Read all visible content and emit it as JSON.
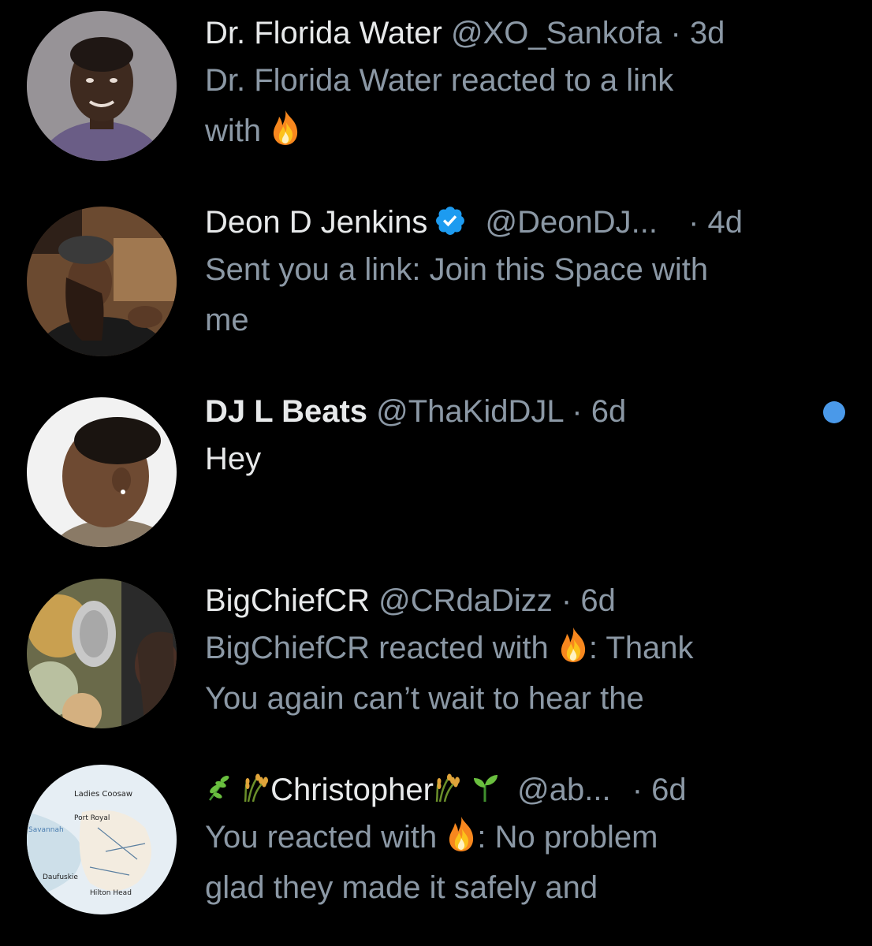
{
  "conversations": [
    {
      "name": "Dr. Florida Water",
      "handle": "@XO_Sankofa",
      "separator": "·",
      "time": "3d",
      "preview_line1": "Dr. Florida Water reacted to a link",
      "preview_line2": "with",
      "reaction_icon": "fire-emoji"
    },
    {
      "name": "Deon D Jenkins",
      "handle": "@DeonDJ...",
      "separator": "·",
      "time": "4d",
      "verified": true,
      "preview_line1": "Sent you a link: Join this Space with",
      "preview_line2": "me"
    },
    {
      "name": "DJ L Beats",
      "handle": "@ThaKidDJL",
      "separator": "·",
      "time": "6d",
      "unread": true,
      "preview_line1": "Hey"
    },
    {
      "name": "BigChiefCR",
      "handle": "@CRdaDizz",
      "separator": "·",
      "time": "6d",
      "preview_line1_a": "BigChiefCR reacted with",
      "preview_line1_b": ": Thank",
      "preview_line2": "You again can’t wait to hear the",
      "reaction_icon": "fire-emoji"
    },
    {
      "name": "Christopher",
      "name_emojis": [
        "herb-emoji",
        "sheaf-of-rice-emoji",
        "sheaf-of-rice-emoji",
        "seedling-emoji"
      ],
      "handle": "@ab...",
      "separator": "·",
      "time": "6d",
      "preview_line1_a": "You reacted with",
      "preview_line1_b": ": No problem",
      "preview_line2": "glad they made it safely and",
      "reaction_icon": "fire-emoji"
    }
  ],
  "colors": {
    "background": "#000000",
    "primary_text": "#e7e9ea",
    "secondary_text": "#8b98a5",
    "verified_blue": "#1d9bf0",
    "unread_dot": "#4a99e9"
  }
}
